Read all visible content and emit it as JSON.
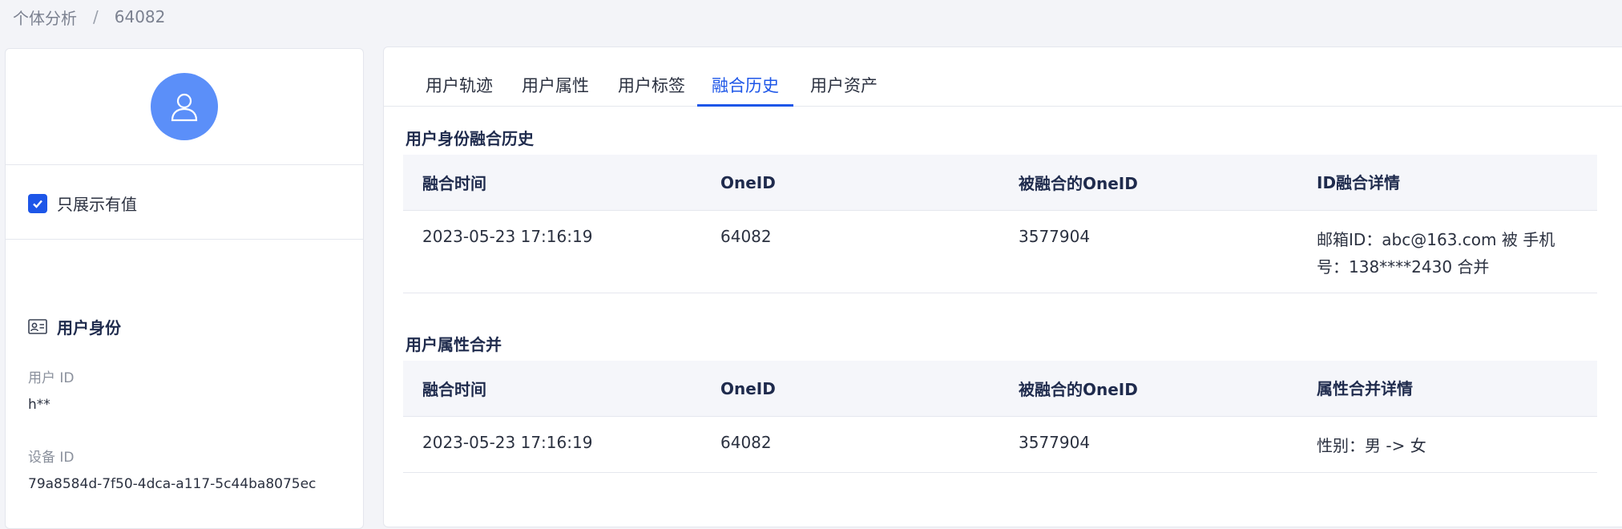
{
  "breadcrumb": {
    "root": "个体分析",
    "separator": "/",
    "current": "64082"
  },
  "sidebar": {
    "show_nonempty_label": "只展示有值",
    "show_nonempty_checked": true,
    "identity_title": "用户身份",
    "fields": [
      {
        "label": "用户 ID",
        "value": "h**"
      },
      {
        "label": "设备 ID",
        "value": "79a8584d-7f50-4dca-a117-5c44ba8075ec"
      }
    ]
  },
  "tabs": [
    {
      "label": "用户轨迹",
      "active": false
    },
    {
      "label": "用户属性",
      "active": false
    },
    {
      "label": "用户标签",
      "active": false
    },
    {
      "label": "融合历史",
      "active": true
    },
    {
      "label": "用户资产",
      "active": false
    }
  ],
  "identity_merge": {
    "title": "用户身份融合历史",
    "headers": [
      "融合时间",
      "OneID",
      "被融合的OneID",
      "ID融合详情"
    ],
    "rows": [
      [
        "2023-05-23 17:16:19",
        "64082",
        "3577904",
        "邮箱ID：abc@163.com 被 手机号：138****2430 合并"
      ]
    ]
  },
  "attribute_merge": {
    "title": "用户属性合并",
    "headers": [
      "融合时间",
      "OneID",
      "被融合的OneID",
      "属性合并详情"
    ],
    "rows": [
      [
        "2023-05-23 17:16:19",
        "64082",
        "3577904",
        "性别：男 -> 女"
      ]
    ]
  },
  "colors": {
    "accent": "#1d56e8",
    "avatar": "#5b8ff9",
    "background": "#f3f4f8"
  },
  "icons": {
    "avatar": "user-icon",
    "checkbox": "check-icon",
    "identity": "id-card-icon"
  }
}
